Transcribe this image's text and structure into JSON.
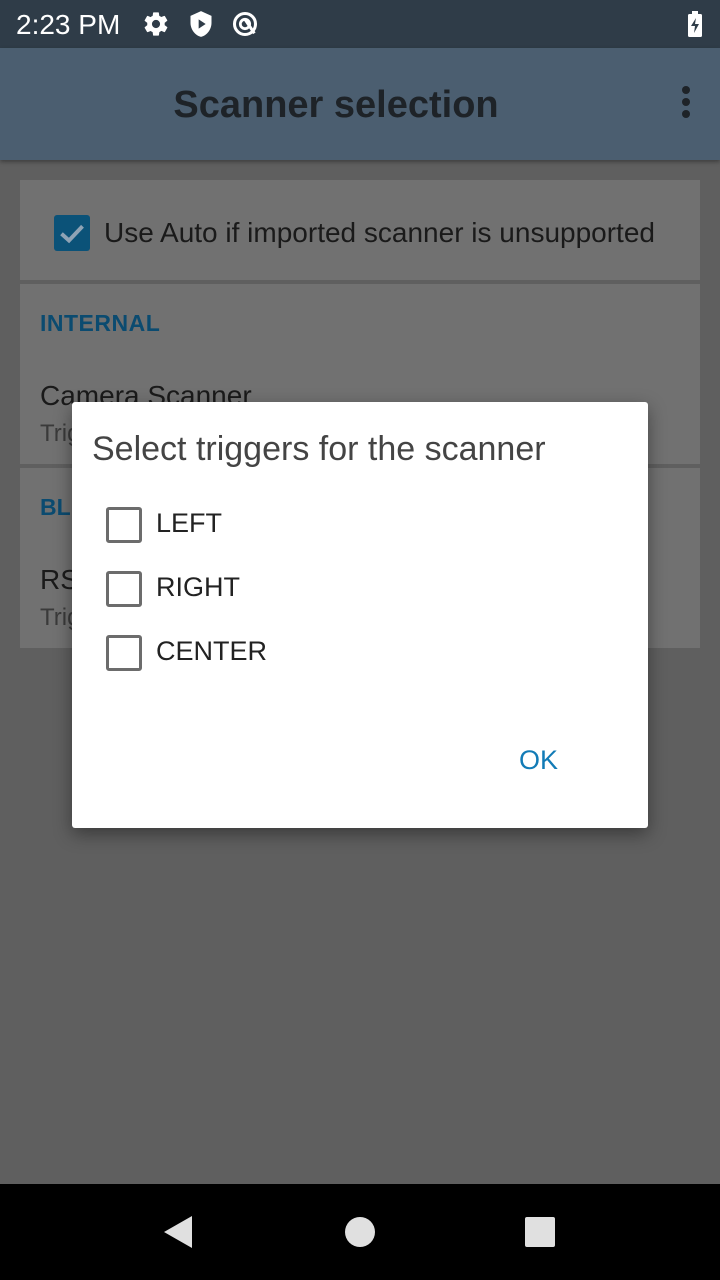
{
  "status_bar": {
    "time": "2:23 PM",
    "icons": [
      "settings-icon",
      "shield-icon",
      "sync-icon",
      "battery-charging-icon"
    ]
  },
  "app_bar": {
    "title": "Scanner selection",
    "menu_icon": "more-vert-icon"
  },
  "settings": {
    "auto_option": {
      "label": "Use Auto if imported scanner is unsupported",
      "checked": true
    },
    "internal": {
      "header": "INTERNAL",
      "item_title": "Camera Scanner",
      "item_subtitle": "Trig"
    },
    "bluetooth": {
      "header": "BLU",
      "item_title": "RS",
      "item_subtitle": "Trig"
    }
  },
  "dialog": {
    "title": "Select triggers for the scanner",
    "options": [
      {
        "label": "LEFT",
        "checked": false
      },
      {
        "label": "RIGHT",
        "checked": false
      },
      {
        "label": "CENTER",
        "checked": false
      }
    ],
    "ok_label": "OK"
  },
  "nav_bar": {
    "icons": [
      "back-icon",
      "home-icon",
      "recents-icon"
    ]
  },
  "colors": {
    "accent": "#127bb6",
    "checkbox_checked": "#0b5278",
    "status_bar": "#2f3c48",
    "app_bar": "#4b5e70"
  }
}
